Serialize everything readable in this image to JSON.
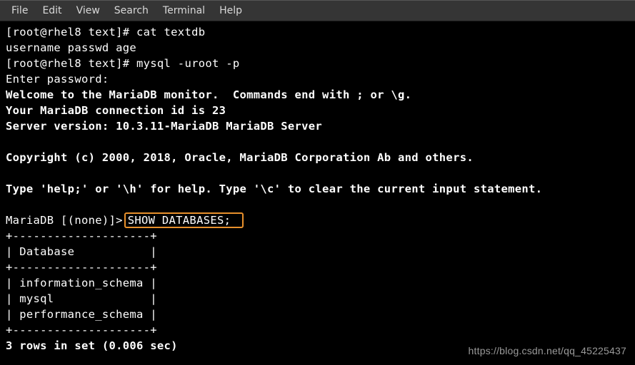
{
  "menubar": {
    "items": [
      "File",
      "Edit",
      "View",
      "Search",
      "Terminal",
      "Help"
    ]
  },
  "terminal": {
    "line1_prompt": "[root@rhel8 text]# ",
    "line1_cmd": "cat textdb",
    "line2": "username passwd age",
    "line3_prompt": "[root@rhel8 text]# ",
    "line3_cmd": "mysql -uroot -p",
    "line4": "Enter password:",
    "line5": "Welcome to the MariaDB monitor.  Commands end with ; or \\g.",
    "line6": "Your MariaDB connection id is 23",
    "line7": "Server version: 10.3.11-MariaDB MariaDB Server",
    "line8": "",
    "line9": "Copyright (c) 2000, 2018, Oracle, MariaDB Corporation Ab and others.",
    "line10": "",
    "line11": "Type 'help;' or '\\h' for help. Type '\\c' to clear the current input statement.",
    "line12": "",
    "line13_prompt": "MariaDB [(none)]>",
    "line13_cmd": "SHOW DATABASES; ",
    "table": {
      "border": "+--------------------+",
      "header": "| Database           |",
      "rows": [
        "| information_schema |",
        "| mysql              |",
        "| performance_schema |"
      ]
    },
    "result": "3 rows in set (0.006 sec)"
  },
  "watermark": "https://blog.csdn.net/qq_45225437"
}
